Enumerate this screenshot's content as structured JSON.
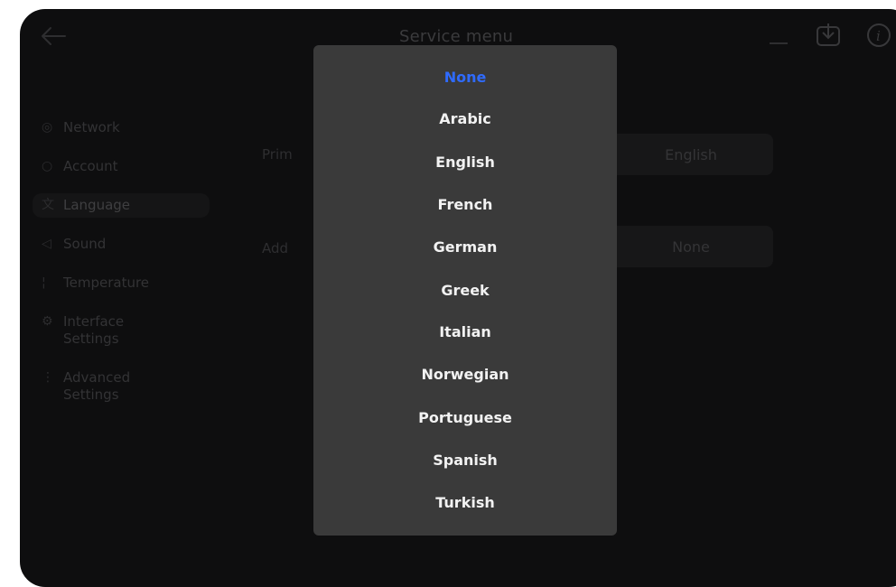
{
  "header": {
    "title": "Service menu"
  },
  "sidebar": {
    "items": [
      {
        "label": "Network",
        "icon": "globe-icon"
      },
      {
        "label": "Account",
        "icon": "user-icon"
      },
      {
        "label": "Language",
        "icon": "translate-icon",
        "active": true
      },
      {
        "label": "Sound",
        "icon": "speaker-icon"
      },
      {
        "label": "Temperature",
        "icon": "thermometer-icon"
      },
      {
        "label": "Interface Settings",
        "icon": "settings-icon"
      },
      {
        "label": "Advanced Settings",
        "icon": "more-vertical-icon"
      }
    ]
  },
  "content": {
    "primary": {
      "label_partial": "Prim",
      "value": "English"
    },
    "additional": {
      "label_partial": "Add",
      "value": "None"
    }
  },
  "dropdown": {
    "selected": "None",
    "options": [
      "None",
      "Arabic",
      "English",
      "French",
      "German",
      "Greek",
      "Italian",
      "Norwegian",
      "Portuguese",
      "Spanish",
      "Turkish"
    ]
  },
  "colors": {
    "accent": "#2f6bff",
    "panel": "#3a3a3a",
    "background": "#0e0e0f"
  }
}
